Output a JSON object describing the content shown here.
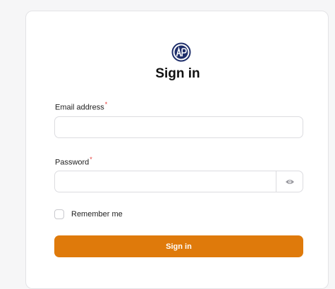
{
  "logo": {
    "icon": "ajp-logo-icon",
    "text": "AJP",
    "color": "#1f2f6b"
  },
  "title": "Sign in",
  "email": {
    "label": "Email address",
    "required_mark": "*",
    "value": "",
    "placeholder": ""
  },
  "password": {
    "label": "Password",
    "required_mark": "*",
    "value": "",
    "placeholder": "",
    "toggle_icon": "eye-icon"
  },
  "remember": {
    "label": "Remember me",
    "checked": false
  },
  "submit": {
    "label": "Sign in",
    "color": "#df7a0b"
  },
  "colors": {
    "required": "#e53935",
    "border": "#dcdce0",
    "background": "#f6f6f7"
  }
}
